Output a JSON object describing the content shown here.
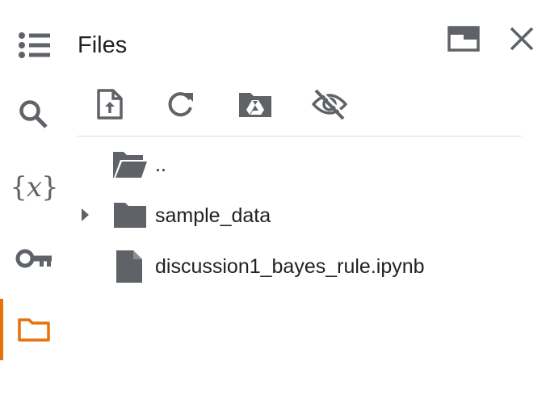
{
  "panel": {
    "title": "Files"
  },
  "left_rail": {
    "items": [
      {
        "name": "table-of-contents",
        "icon": "list-icon"
      },
      {
        "name": "find-and-replace",
        "icon": "search-icon"
      },
      {
        "name": "variables",
        "icon": "variables-icon",
        "glyph_open": "{",
        "glyph_var": "x",
        "glyph_close": "}"
      },
      {
        "name": "secrets",
        "icon": "key-icon"
      },
      {
        "name": "files",
        "icon": "folder-icon",
        "active": true
      }
    ],
    "accent_color": "#e8710a"
  },
  "toolbar": {
    "buttons": [
      {
        "name": "upload",
        "icon": "upload-file-icon"
      },
      {
        "name": "refresh",
        "icon": "refresh-icon"
      },
      {
        "name": "mount-drive",
        "icon": "drive-folder-icon"
      },
      {
        "name": "toggle-hidden-files",
        "icon": "eye-off-icon"
      }
    ]
  },
  "tree": {
    "items": [
      {
        "label": "..",
        "icon": "folder-open-icon",
        "expandable": false
      },
      {
        "label": "sample_data",
        "icon": "folder-icon",
        "expandable": true
      },
      {
        "label": "discussion1_bayes_rule.ipynb",
        "icon": "file-icon",
        "expandable": false
      }
    ]
  },
  "colors": {
    "icon": "#5f6368",
    "text": "#202124",
    "divider": "#dadce0"
  }
}
